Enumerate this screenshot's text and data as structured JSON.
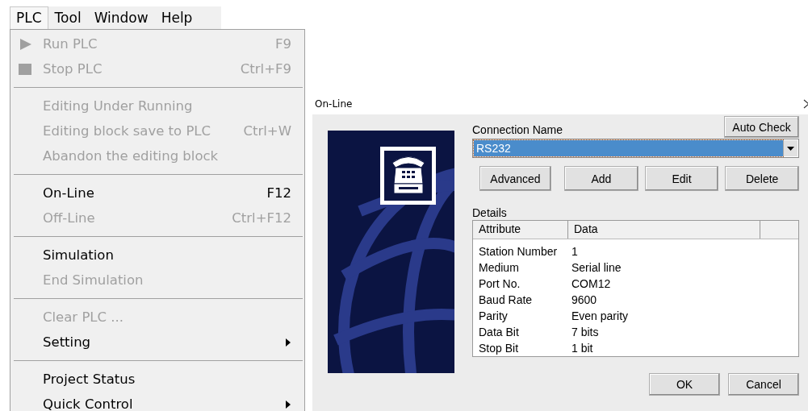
{
  "menubar": [
    {
      "label": "PLC",
      "selected": true
    },
    {
      "label": "Tool",
      "selected": false
    },
    {
      "label": "Window",
      "selected": false
    },
    {
      "label": "Help",
      "selected": false
    }
  ],
  "menu": {
    "groups": [
      [
        {
          "label": "Run PLC",
          "shortcut": "F9",
          "disabled": true,
          "submenu": false
        },
        {
          "label": "Stop PLC",
          "shortcut": "Ctrl+F9",
          "disabled": true,
          "submenu": false
        }
      ],
      [
        {
          "label": "Editing Under Running",
          "disabled": true,
          "submenu": false
        },
        {
          "label": "Editing block save to PLC",
          "shortcut": "Ctrl+W",
          "disabled": true,
          "submenu": false
        },
        {
          "label": "Abandon the editing block",
          "disabled": true,
          "submenu": false
        }
      ],
      [
        {
          "label": "On-Line",
          "shortcut": "F12",
          "disabled": false,
          "submenu": false
        },
        {
          "label": "Off-Line",
          "shortcut": "Ctrl+F12",
          "disabled": true,
          "submenu": false
        }
      ],
      [
        {
          "label": "Simulation",
          "disabled": false,
          "submenu": false
        },
        {
          "label": "End Simulation",
          "disabled": true,
          "submenu": false
        }
      ],
      [
        {
          "label": "Clear PLC ...",
          "disabled": true,
          "submenu": false
        },
        {
          "label": "Setting",
          "disabled": false,
          "submenu": true
        }
      ],
      [
        {
          "label": "Project Status",
          "disabled": false,
          "submenu": false
        },
        {
          "label": "Quick Control",
          "disabled": false,
          "submenu": true
        }
      ]
    ]
  },
  "dialog": {
    "title": "On-Line",
    "auto_check": "Auto Check",
    "connection_label": "Connection Name",
    "connection_value": "RS232",
    "buttons": [
      "Advanced",
      "Add",
      "Edit",
      "Delete"
    ],
    "details_label": "Details",
    "table": {
      "columns": [
        "Attribute",
        "Data"
      ],
      "rows": [
        [
          "Station Number",
          "1"
        ],
        [
          "Medium",
          "Serial line"
        ],
        [
          "Port No.",
          "COM12"
        ],
        [
          "Baud Rate",
          "9600"
        ],
        [
          "Parity",
          "Even parity"
        ],
        [
          "Data Bit",
          "7 bits"
        ],
        [
          "Stop Bit",
          "1 bit"
        ]
      ]
    },
    "footer_buttons": [
      "OK",
      "Cancel"
    ]
  }
}
